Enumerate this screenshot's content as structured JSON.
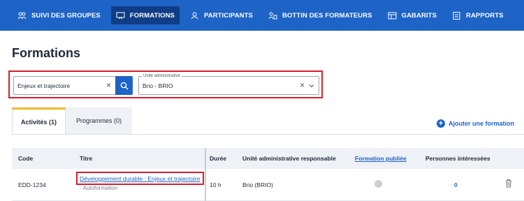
{
  "nav": {
    "items": [
      {
        "label": "SUIVI DES GROUPES",
        "icon": "groups-icon",
        "active": false
      },
      {
        "label": "FORMATIONS",
        "icon": "presentation-icon",
        "active": true
      },
      {
        "label": "PARTICIPANTS",
        "icon": "participants-icon",
        "active": false
      },
      {
        "label": "BOTTIN DES FORMATEURS",
        "icon": "trainer-directory-icon",
        "active": false
      },
      {
        "label": "GABARITS",
        "icon": "template-icon",
        "active": false
      },
      {
        "label": "RAPPORTS",
        "icon": "report-icon",
        "active": false
      }
    ]
  },
  "page": {
    "title": "Formations"
  },
  "filters": {
    "search_value": "Enjeux et trajectoire",
    "unit_label": "Unité administrative",
    "unit_value": "Brio - BRIO"
  },
  "tabs": [
    {
      "label": "Activités (1)",
      "active": true
    },
    {
      "label": "Programmes (0)",
      "active": false
    }
  ],
  "actions": {
    "add_label": "Ajouter une formation"
  },
  "table": {
    "headers": {
      "code": "Code",
      "titre": "Titre",
      "duree": "Durée",
      "unite": "Unité administrative responsable",
      "publiee": "Formation publiée",
      "interessees": "Personnes intéressées"
    },
    "rows": [
      {
        "code": "EDD-1234",
        "titre": "Développement durable : Enjeux et trajectoire",
        "sous_titre": "- Autoformation",
        "duree": "10 h",
        "unite": "Brio (BRIO)",
        "publiee": false,
        "interessees": "0"
      }
    ]
  },
  "colors": {
    "primary": "#1e63c6",
    "nav_active": "#0f3e86",
    "highlight": "#d51e2b",
    "tab_accent": "#f0b52b"
  }
}
